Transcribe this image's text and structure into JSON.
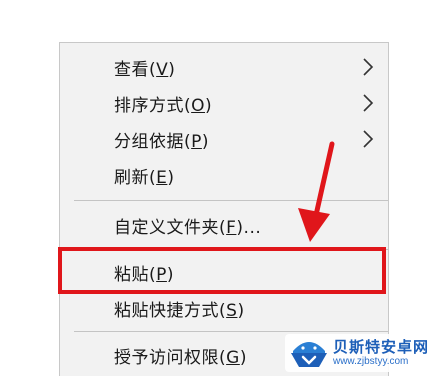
{
  "context_menu": {
    "items": [
      {
        "id": "view",
        "text": "查看(",
        "key": "V",
        "tail": ")",
        "submenu": true
      },
      {
        "id": "sort",
        "text": "排序方式(",
        "key": "O",
        "tail": ")",
        "submenu": true
      },
      {
        "id": "group",
        "text": "分组依据(",
        "key": "P",
        "tail": ")",
        "submenu": true
      },
      {
        "id": "refresh",
        "text": "刷新(",
        "key": "E",
        "tail": ")",
        "submenu": false
      },
      {
        "id": "customize",
        "text": "自定义文件夹(",
        "key": "F",
        "tail": ")...",
        "submenu": false
      },
      {
        "id": "paste",
        "text": "粘贴(",
        "key": "P",
        "tail": ")",
        "submenu": false
      },
      {
        "id": "paste-shortcut",
        "text": "粘贴快捷方式(",
        "key": "S",
        "tail": ")",
        "submenu": false
      },
      {
        "id": "give-access",
        "text": "授予访问权限(",
        "key": "G",
        "tail": ")",
        "submenu": true
      }
    ]
  },
  "watermark": {
    "title": "贝斯特安卓网",
    "url": "www.zjbstyy.com"
  },
  "colors": {
    "highlight": "#e0161b",
    "menu_bg": "#f2f2f2",
    "watermark_blue": "#1d5fb8"
  }
}
